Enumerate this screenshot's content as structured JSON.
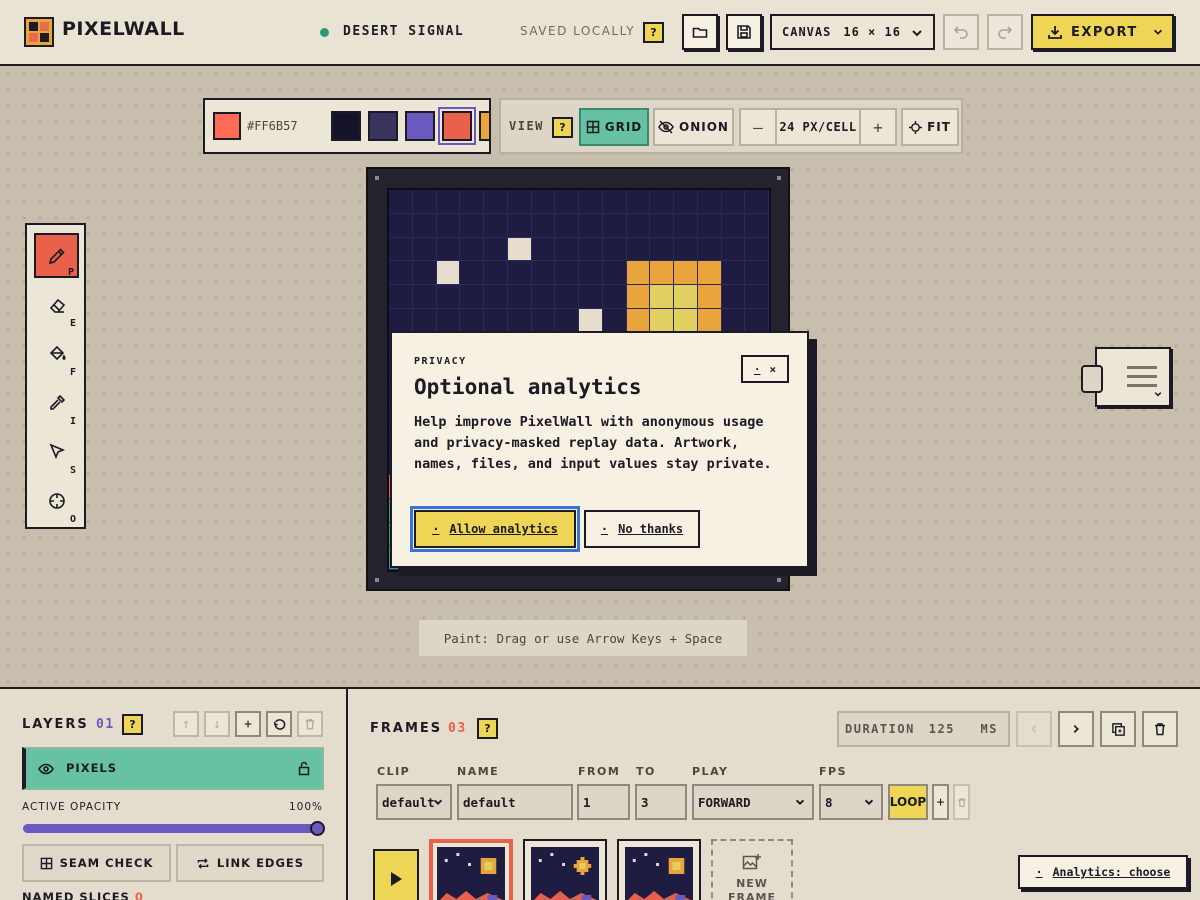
{
  "app": {
    "name": "PIXELWALL"
  },
  "project": {
    "name": "DESERT SIGNAL",
    "saved_status": "SAVED LOCALLY",
    "help": "?"
  },
  "canvas_select": {
    "label": "CANVAS",
    "value": "16 × 16"
  },
  "export": {
    "label": "EXPORT"
  },
  "palette": {
    "current_hex": "#FF6B57",
    "colors": [
      "#15132a",
      "#39345e",
      "#6a5ac0",
      "#e9604b",
      "#e9a53c"
    ],
    "selected_index": 3
  },
  "view": {
    "label": "VIEW",
    "help": "?",
    "grid_label": "GRID",
    "onion_label": "ONION",
    "zoom_value": "24 PX/CELL",
    "fit_label": "FIT"
  },
  "tools": [
    {
      "name": "pencil",
      "key": "P",
      "active": true
    },
    {
      "name": "eraser",
      "key": "E",
      "active": false
    },
    {
      "name": "fill",
      "key": "F",
      "active": false
    },
    {
      "name": "eyedropper",
      "key": "I",
      "active": false
    },
    {
      "name": "select",
      "key": "S",
      "active": false
    },
    {
      "name": "origin",
      "key": "O",
      "active": false
    }
  ],
  "hint": "Paint: Drag or use Arrow Keys + Space",
  "modal": {
    "eyebrow": "PRIVACY",
    "title": "Optional analytics",
    "close_label": "×",
    "close_key": "·",
    "body": "Help improve PixelWall with anonymous usage and privacy-masked replay data. Artwork, names, files, and input values stay private.",
    "allow_label": "Allow analytics",
    "allow_key": "·",
    "decline_label": "No thanks",
    "decline_key": "·"
  },
  "layers": {
    "title": "LAYERS",
    "count": "01",
    "help": "?",
    "items": [
      {
        "name": "PIXELS",
        "visible": true,
        "locked": false
      }
    ],
    "opacity_label": "ACTIVE OPACITY",
    "opacity_value": "100%",
    "opacity": 1.0,
    "seam_check_label": "SEAM CHECK",
    "link_edges_label": "LINK EDGES",
    "named_slices_label": "NAMED SLICES",
    "named_slices_count": "0"
  },
  "frames": {
    "title": "FRAMES",
    "count": "03",
    "help": "?",
    "duration_label": "DURATION",
    "duration_value": "125",
    "duration_unit": "MS",
    "clip_label": "CLIP",
    "clip_value": "default",
    "name_label": "NAME",
    "name_value": "default",
    "from_label": "FROM",
    "from_value": "1",
    "to_label": "TO",
    "to_value": "3",
    "play_label": "PLAY",
    "play_value": "FORWARD",
    "fps_label": "FPS",
    "fps_value": "8",
    "loop_label": "LOOP",
    "new_frame_label": "NEW FRAME",
    "selected_index": 0
  },
  "toast": {
    "key": "·",
    "label": "Analytics: choose"
  },
  "colors": {
    "accent_yellow": "#efd556",
    "accent_red": "#e9604b",
    "accent_green": "#66c2a2",
    "accent_purple": "#6a5ac0",
    "ink": "#1c1a24"
  }
}
